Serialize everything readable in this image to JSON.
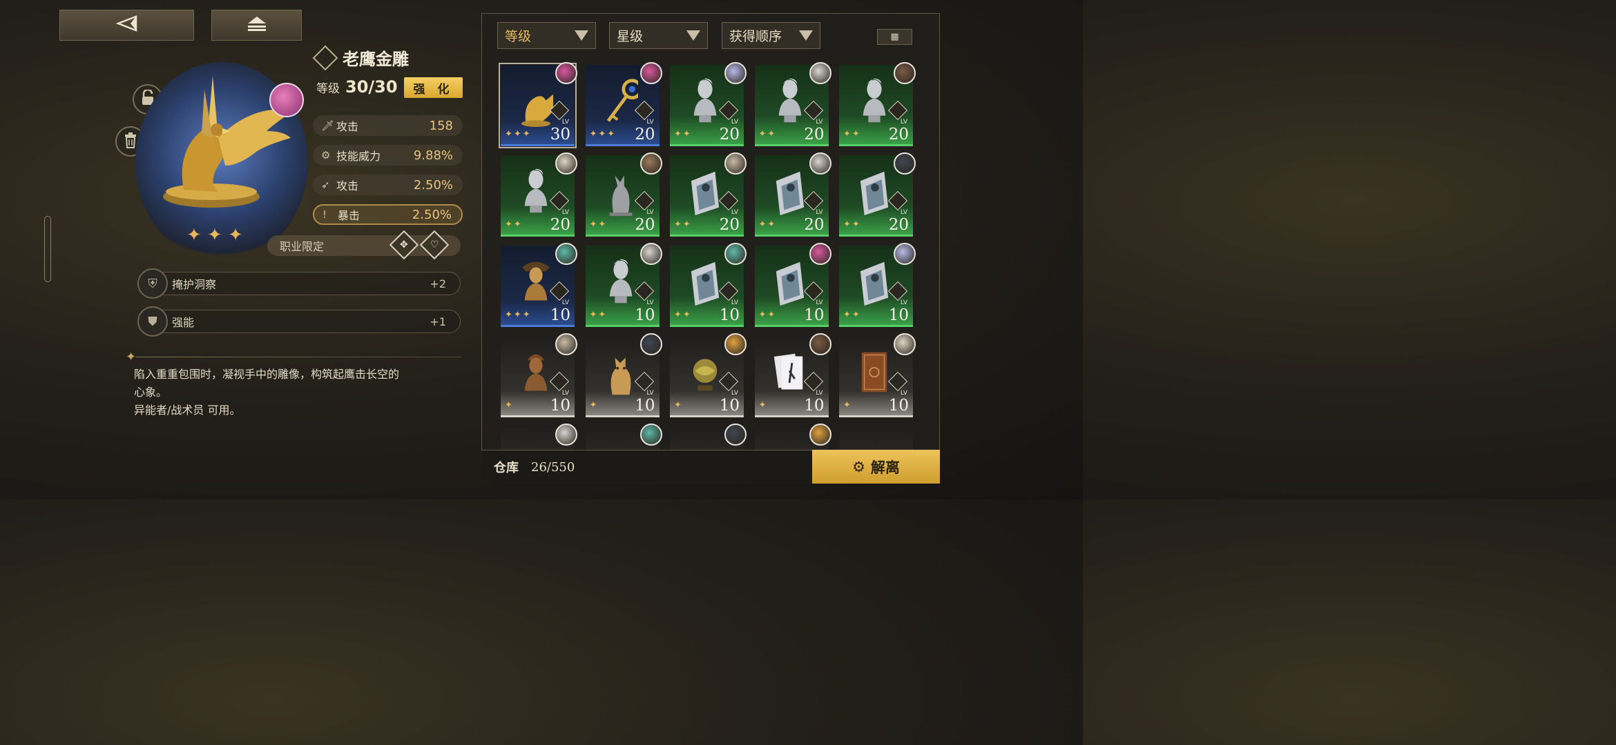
{
  "colors": {
    "accent_gold": "#e8b857",
    "green_rarity": "#3aa047",
    "blue_rarity": "#4a7bdd",
    "gray_rarity": "#8a8680"
  },
  "nav": {
    "back_icon": "back-triangle-icon",
    "eject_icon": "eject-icon"
  },
  "item": {
    "name": "老鹰金雕",
    "level_label": "等级",
    "level_value": "30/30",
    "enhance_label": "强 化",
    "stars": "✦ ✦ ✦",
    "stats": [
      {
        "icon": "sword-icon",
        "name": "攻击",
        "value": "158"
      },
      {
        "icon": "gear-icon",
        "name": "技能威力",
        "value": "9.88%"
      },
      {
        "icon": "arrow-icon",
        "name": "攻击",
        "value": "2.50%"
      },
      {
        "icon": "exclamation-icon",
        "name": "暴击",
        "value": "2.50%"
      }
    ],
    "job_limit_label": "职业限定",
    "skills": [
      {
        "name": "掩护洞察",
        "value": "+2"
      },
      {
        "name": "强能",
        "value": "+1"
      }
    ],
    "description": [
      "陷入重重包围时，凝视手中的雕像，构筑起鹰击长空的",
      "心象。",
      "异能者/战术员 可用。"
    ]
  },
  "filters": {
    "level": "等级",
    "stars": "星级",
    "acquire_order": "获得顺序"
  },
  "grid": {
    "lv_tag": "LV",
    "tiles": [
      {
        "rarity": "blue",
        "level": "30",
        "stars": 3,
        "selected": true,
        "object": "eagle",
        "avatar": "#d9589f"
      },
      {
        "rarity": "blue",
        "level": "20",
        "stars": 3,
        "object": "key",
        "avatar": "#d9589f"
      },
      {
        "rarity": "green",
        "level": "20",
        "stars": 2,
        "object": "bust",
        "avatar": "#b7b9e8"
      },
      {
        "rarity": "green",
        "level": "20",
        "stars": 2,
        "object": "bust",
        "avatar": "#d8d4cf"
      },
      {
        "rarity": "green",
        "level": "20",
        "stars": 2,
        "object": "bust",
        "avatar": "#7a5a45"
      },
      {
        "rarity": "green",
        "level": "20",
        "stars": 2,
        "object": "bust",
        "avatar": "#e0d6c4"
      },
      {
        "rarity": "green",
        "level": "20",
        "stars": 2,
        "object": "cat",
        "avatar": "#9a7a5a"
      },
      {
        "rarity": "green",
        "level": "20",
        "stars": 2,
        "object": "frame",
        "avatar": "#c9b9a4"
      },
      {
        "rarity": "green",
        "level": "20",
        "stars": 2,
        "object": "frame",
        "avatar": "#d8d4cf"
      },
      {
        "rarity": "green",
        "level": "20",
        "stars": 2,
        "object": "frame",
        "avatar": "#3e4650"
      },
      {
        "rarity": "blue",
        "level": "10",
        "stars": 3,
        "object": "napoleon",
        "avatar": "#5fb8a6"
      },
      {
        "rarity": "green",
        "level": "10",
        "stars": 2,
        "object": "bust",
        "avatar": "#d8d4cf"
      },
      {
        "rarity": "green",
        "level": "10",
        "stars": 2,
        "object": "frame",
        "avatar": "#5fb8a6"
      },
      {
        "rarity": "green",
        "level": "10",
        "stars": 2,
        "object": "frame",
        "avatar": "#d9589f"
      },
      {
        "rarity": "green",
        "level": "10",
        "stars": 2,
        "object": "frame",
        "avatar": "#b7b9e8"
      },
      {
        "rarity": "gray",
        "level": "10",
        "stars": 1,
        "object": "bronze-bust",
        "avatar": "#c9b9a4"
      },
      {
        "rarity": "gray",
        "level": "10",
        "stars": 1,
        "object": "gold-cat",
        "avatar": "#3e4650"
      },
      {
        "rarity": "gray",
        "level": "10",
        "stars": 1,
        "object": "globe",
        "avatar": "#e0a040"
      },
      {
        "rarity": "gray",
        "level": "10",
        "stars": 1,
        "object": "cards",
        "avatar": "#7a5a45"
      },
      {
        "rarity": "gray",
        "level": "10",
        "stars": 1,
        "object": "book",
        "avatar": "#e0d6c4"
      },
      {
        "rarity": "gray",
        "level": "",
        "stars": 0,
        "object": "",
        "avatar": "#d8d4cf"
      },
      {
        "rarity": "gray",
        "level": "",
        "stars": 0,
        "object": "",
        "avatar": "#5fb8a6"
      },
      {
        "rarity": "gray",
        "level": "",
        "stars": 0,
        "object": "",
        "avatar": "#3e4650"
      },
      {
        "rarity": "gray",
        "level": "",
        "stars": 0,
        "object": "",
        "avatar": "#e0a040"
      },
      {
        "rarity": "gray",
        "level": "",
        "stars": 0,
        "object": "",
        "avatar": ""
      }
    ]
  },
  "storage": {
    "label": "仓库",
    "value": "26/550"
  },
  "dismantle_label": "解离"
}
